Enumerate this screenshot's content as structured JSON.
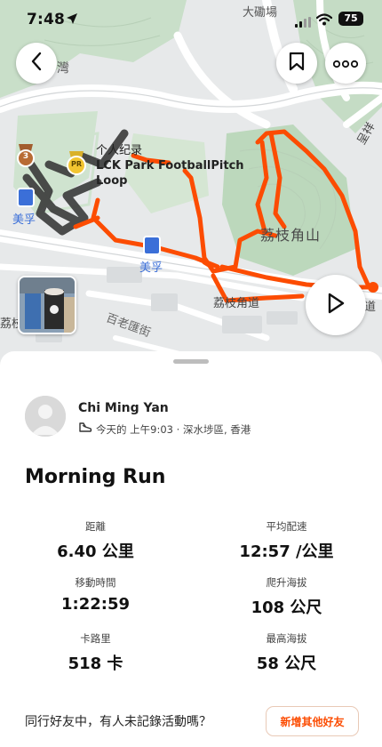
{
  "status_bar": {
    "time": "7:48",
    "battery": "75"
  },
  "map": {
    "labels": {
      "tai_hom": "大磡場",
      "wan": "灣",
      "mei_fu_1": "美孚",
      "mei_fu_2": "美孚",
      "lai_chi_kok_shan": "荔枝角山",
      "lai_chi_kok_road": "荔枝角道",
      "pak_lo_wui": "百老匯街",
      "lai_chi": "荔枝",
      "road_end": "道",
      "cheng_partial": "呈祥"
    },
    "poi": {
      "line1": "个人纪录",
      "line2": "LCK Park FootballPitch",
      "line3": "Loop"
    },
    "badges": {
      "trophy_number": "3",
      "pr_label": "PR"
    },
    "route_color": "#fc4c02"
  },
  "icons": {
    "back": "chevron-left-icon",
    "bookmark": "bookmark-icon",
    "more": "more-horizontal-icon",
    "play": "play-icon",
    "shoe": "shoe-icon",
    "location": "location-arrow-icon"
  },
  "activity": {
    "athlete": "Chi Ming Yan",
    "meta": "今天的 上午9:03 · 深水埗區, 香港",
    "title": "Morning Run",
    "stats": [
      {
        "label": "距離",
        "value": "6.40 公里"
      },
      {
        "label": "平均配速",
        "value": "12:57 /公里"
      },
      {
        "label": "移動時間",
        "value": "1:22:59"
      },
      {
        "label": "爬升海拔",
        "value": "108 公尺"
      },
      {
        "label": "卡路里",
        "value": "518 卡"
      },
      {
        "label": "最高海拔",
        "value": "58 公尺"
      }
    ]
  },
  "footer": {
    "prompt": "同行好友中，有人未記錄活動嗎？",
    "button": "新增其他好友"
  }
}
